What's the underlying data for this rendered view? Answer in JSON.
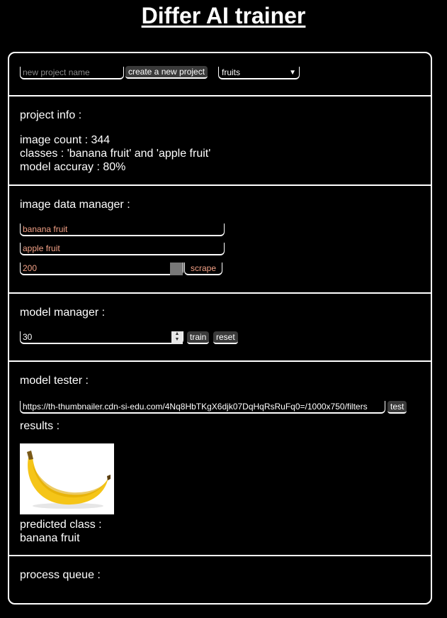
{
  "title": "Differ AI trainer",
  "project_bar": {
    "new_project_placeholder": "new project name",
    "create_button": "create a new project",
    "project_select_value": "fruits"
  },
  "project_info": {
    "heading": "project info :",
    "image_count": "image count : 344",
    "classes": "classes : 'banana fruit' and 'apple fruit'",
    "accuracy": "model accuray : 80%"
  },
  "image_data_manager": {
    "heading": "image data manager :",
    "class_one": "banana fruit",
    "class_two": "apple fruit",
    "count": "200",
    "scrape_button": "scrape"
  },
  "model_manager": {
    "heading": "model manager :",
    "epochs": "30",
    "train_button": "train",
    "reset_button": "reset"
  },
  "model_tester": {
    "heading": "model tester :",
    "url": "https://th-thumbnailer.cdn-si-edu.com/4Nq8HbTKgX6djk07DqHqRsRuFq0=/1000x750/filters",
    "test_button": "test",
    "results_label": "results :",
    "predicted_label": "predicted class :",
    "predicted_value": "banana fruit"
  },
  "process_queue": {
    "heading": "process queue :"
  },
  "icons": {
    "select": "chevron-down-icon",
    "spinner": "spinner-arrows-icon"
  },
  "colors": {
    "background": "#000000",
    "text": "#ffffff",
    "input_value": "#f2a085",
    "button": "#3a3a3a",
    "banana": "#f5c518"
  }
}
